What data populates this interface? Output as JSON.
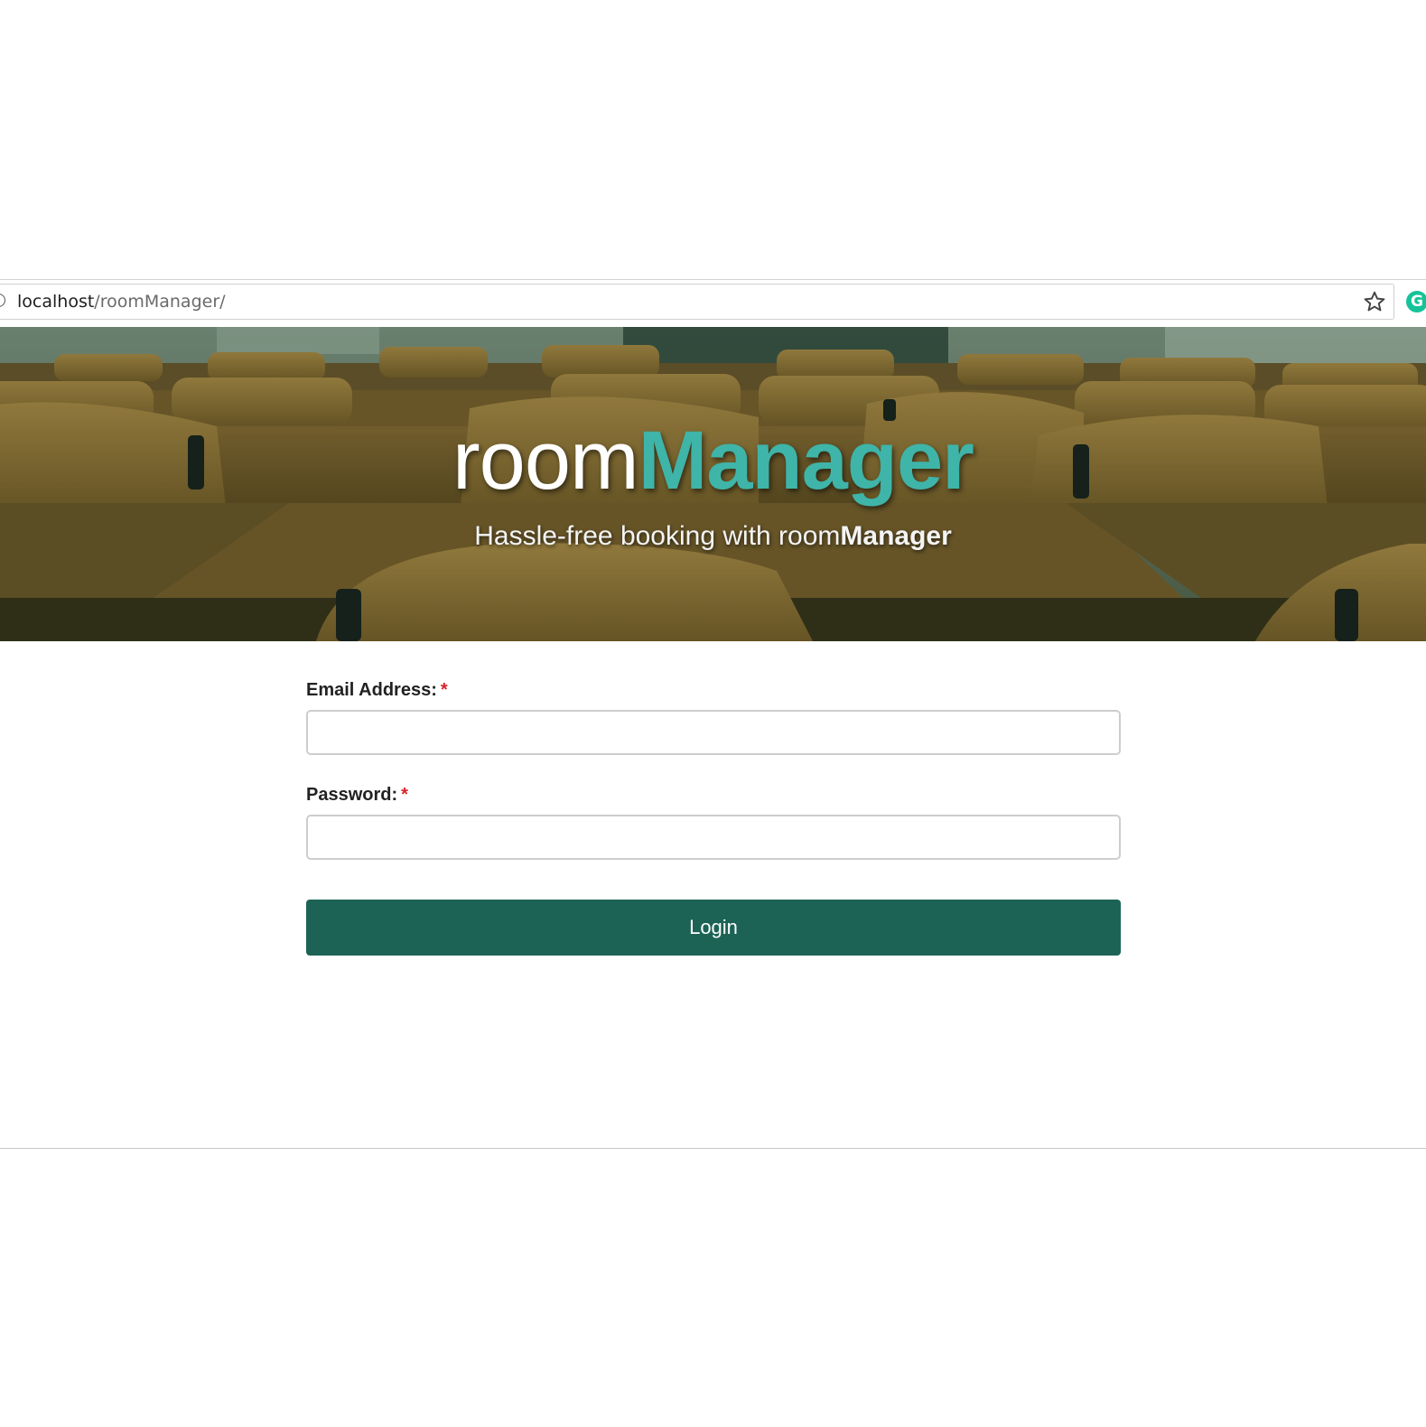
{
  "browser": {
    "url_host": "localhost",
    "url_path": "/roomManager/",
    "info_icon": "info-icon",
    "bookmark_icon": "star-icon",
    "extension_icon": "grammarly-icon",
    "extension_letter": "G"
  },
  "hero": {
    "title_light": "room",
    "title_accent": "Manager",
    "subtitle_prefix": "Hassle-free booking with room",
    "subtitle_bold": "Manager",
    "accent_color": "#3fb4a8"
  },
  "form": {
    "email": {
      "label": "Email Address:",
      "required_mark": "*",
      "value": "",
      "placeholder": ""
    },
    "password": {
      "label": "Password:",
      "required_mark": "*",
      "value": "",
      "placeholder": ""
    },
    "login_label": "Login",
    "button_color": "#1c6356"
  }
}
